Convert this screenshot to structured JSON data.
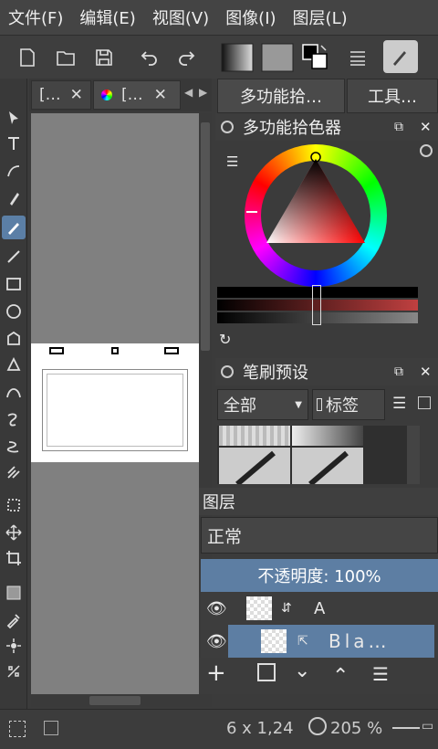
{
  "menu": [
    "文件(F)",
    "编辑(E)",
    "视图(V)",
    "图像(I)",
    "图层(L)"
  ],
  "doc_tabs": [
    "[…",
    "[…"
  ],
  "dock_tabs": [
    "多功能拾…",
    "工具…"
  ],
  "color_panel": {
    "title": "多功能拾色器",
    "hue_color": "#ff0000"
  },
  "brush_panel": {
    "title": "笔刷预设",
    "filter": "全部",
    "tag_label": "标签"
  },
  "layers": {
    "title": "图层",
    "blend_mode": "正常",
    "opacity_text": "不透明度: 100%",
    "items": [
      {
        "name": "A"
      },
      {
        "name": "Bla…"
      }
    ]
  },
  "status": {
    "coords": "6 x 1,24",
    "zoom": "205 %"
  },
  "colors": {
    "accent": "#5d7ea3",
    "panel": "#3d3d3d",
    "canvas": "#808080"
  }
}
